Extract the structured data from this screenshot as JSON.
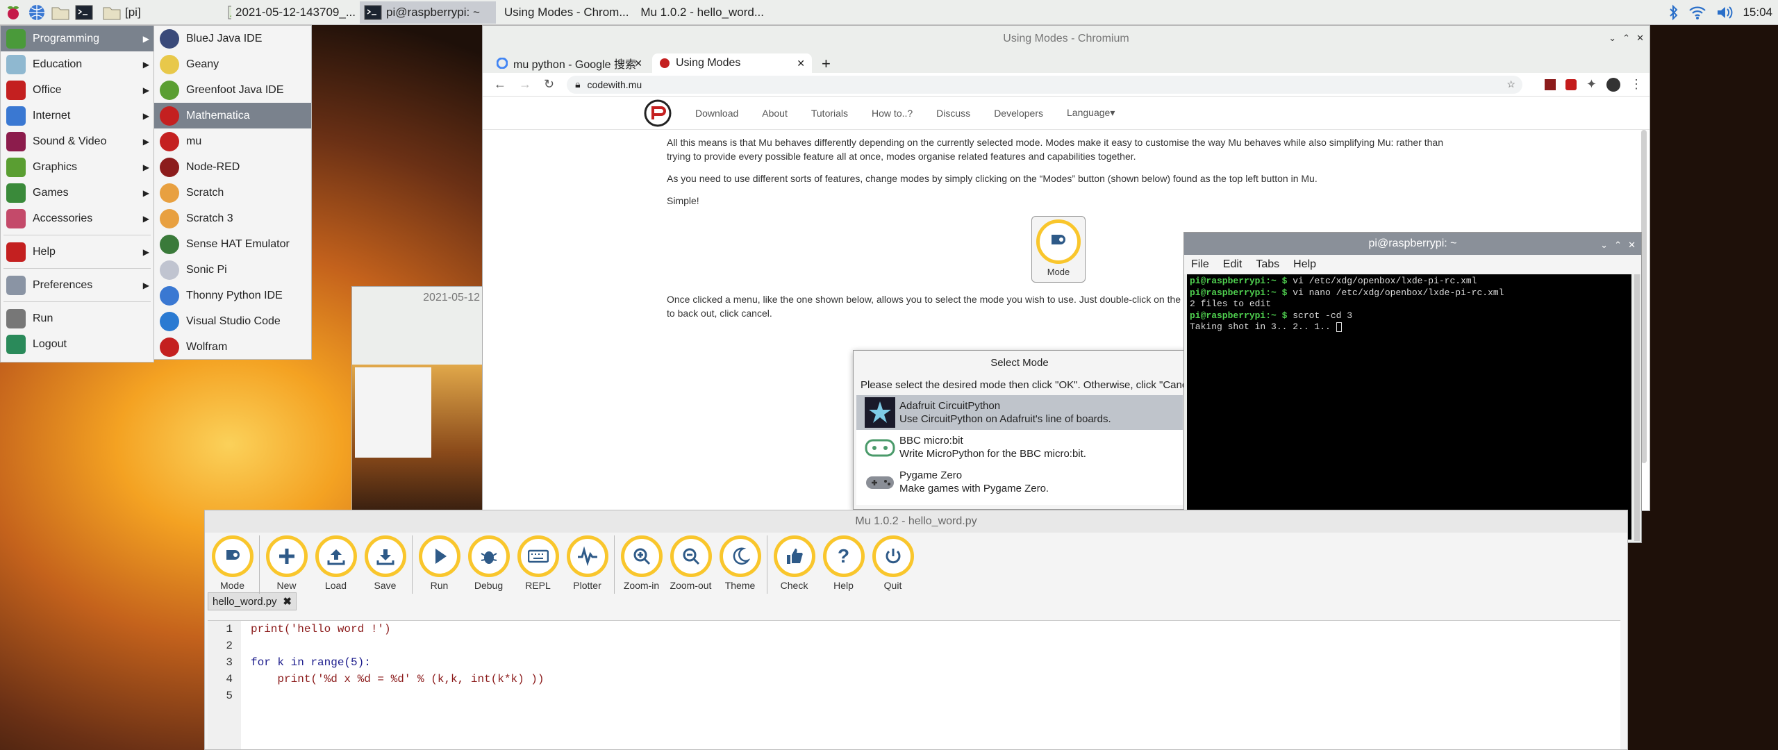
{
  "taskbar": {
    "tasks": [
      "[pi]",
      "2021-05-12-143709_...",
      "pi@raspberrypi: ~",
      "Using Modes - Chrom...",
      "Mu 1.0.2 - hello_word..."
    ],
    "clock": "15:04",
    "icons": [
      "raspberry-icon",
      "globe-icon",
      "folder-icon",
      "terminal-icon",
      "bluetooth-icon",
      "wifi-icon",
      "volume-icon"
    ]
  },
  "main_menu": {
    "items": [
      {
        "label": "Programming",
        "sub": true,
        "selected": true
      },
      {
        "label": "Education",
        "sub": true
      },
      {
        "label": "Office",
        "sub": true
      },
      {
        "label": "Internet",
        "sub": true
      },
      {
        "label": "Sound & Video",
        "sub": true
      },
      {
        "label": "Graphics",
        "sub": true
      },
      {
        "label": "Games",
        "sub": true
      },
      {
        "label": "Accessories",
        "sub": true
      },
      {
        "label": "Help",
        "sub": true
      },
      {
        "label": "Preferences",
        "sub": true
      },
      {
        "label": "Run",
        "sub": false
      },
      {
        "label": "Logout",
        "sub": false
      }
    ]
  },
  "programming_menu": {
    "items": [
      "BlueJ Java IDE",
      "Geany",
      "Greenfoot Java IDE",
      "Mathematica",
      "mu",
      "Node-RED",
      "Scratch",
      "Scratch 3",
      "Sense HAT Emulator",
      "Sonic Pi",
      "Thonny Python IDE",
      "Visual Studio Code",
      "Wolfram"
    ],
    "selected": "Mathematica"
  },
  "screenshot_thumb": {
    "title": "2021-05-12"
  },
  "chromium": {
    "title": "Using Modes - Chromium",
    "tabs": [
      "mu python - Google 搜索",
      "Using Modes"
    ],
    "url": "codewith.mu",
    "nav": [
      "Download",
      "About",
      "Tutorials",
      "How to..?",
      "Discuss",
      "Developers",
      "Language"
    ],
    "paragraphs": [
      "All this means is that Mu behaves differently depending on the currently selected mode. Modes make it easy to customise the way Mu behaves while also simplifying Mu: rather than trying to provide every possible feature all at once, modes organise related features and capabilities together.",
      "As you need to use different sorts of features, change modes by simply clicking on the “Modes” button (shown below) found as the top left button in Mu.",
      "Simple!"
    ],
    "mode_button": "Mode",
    "para_after": "Once clicked a menu, like the one shown below, allows you to select the mode you wish to use. Just double-click on the",
    "para_after2": "to back out, click cancel."
  },
  "select_mode": {
    "title": "Select Mode",
    "prompt": "Please select the desired mode then click \"OK\". Otherwise, click \"Cancel",
    "modes": [
      {
        "name": "Adafruit CircuitPython",
        "desc": "Use CircuitPython on Adafruit's line of boards."
      },
      {
        "name": "BBC micro:bit",
        "desc": "Write MicroPython for the BBC micro:bit."
      },
      {
        "name": "Pygame Zero",
        "desc": "Make games with Pygame Zero."
      }
    ]
  },
  "terminal": {
    "title": "pi@raspberrypi: ~",
    "menu": [
      "File",
      "Edit",
      "Tabs",
      "Help"
    ],
    "lines": [
      {
        "prompt": "pi@raspberrypi:~ $",
        "cmd": " vi /etc/xdg/openbox/lxde-pi-rc.xml"
      },
      {
        "prompt": "pi@raspberrypi:~ $",
        "cmd": " vi nano /etc/xdg/openbox/lxde-pi-rc.xml"
      },
      {
        "prompt": "",
        "cmd": "2 files to edit"
      },
      {
        "prompt": "pi@raspberrypi:~ $",
        "cmd": " scrot -cd 3"
      },
      {
        "prompt": "",
        "cmd": "Taking shot in 3.. 2.. 1.. "
      }
    ]
  },
  "mu": {
    "title": "Mu 1.0.2 - hello_word.py",
    "buttons": [
      "Mode",
      "New",
      "Load",
      "Save",
      "Run",
      "Debug",
      "REPL",
      "Plotter",
      "Zoom-in",
      "Zoom-out",
      "Theme",
      "Check",
      "Help",
      "Quit"
    ],
    "tab": "hello_word.py",
    "lines": [
      "print('hello word !')",
      "",
      "for k in range(5):",
      "    print('%d x %d = %d' % (k,k, int(k*k) ))",
      ""
    ],
    "line_numbers": [
      "1",
      "2",
      "3",
      "4",
      "5"
    ]
  }
}
